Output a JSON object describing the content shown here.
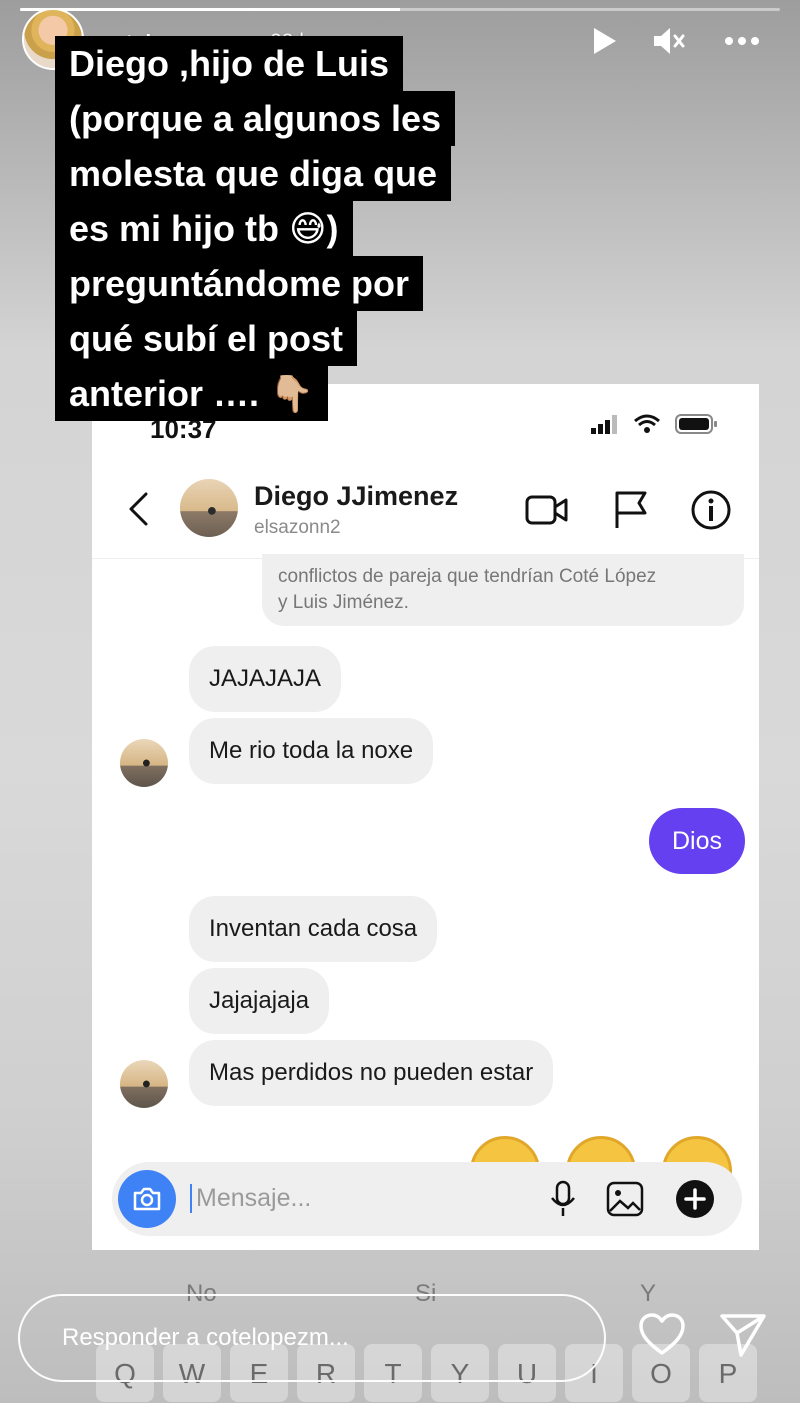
{
  "story": {
    "username": "cotelopezm",
    "time_ago": "22 h",
    "progress_fraction": 0.5,
    "icons": {
      "play": "play-icon",
      "mute": "mute-icon",
      "more": "more-icon"
    },
    "caption_lines": [
      "Diego ,hijo de Luis",
      "(porque a algunos les",
      "molesta que diga que",
      "es mi hijo tb 😅)",
      "preguntándome por",
      "qué subí el post",
      "anterior …. 👇🏼"
    ],
    "reply_placeholder": "Responder a cotelopezm...",
    "footer_icons": {
      "like": "heart-icon",
      "share": "send-icon"
    }
  },
  "phone": {
    "status_time": "10:37",
    "contact": {
      "name": "Diego JJimenez",
      "handle": "elsazonn2"
    },
    "quoted_text_lines": [
      "conflictos de pareja que tendrían Coté López",
      "y Luis Jiménez."
    ],
    "messages": [
      {
        "text": "JAJAJAJA",
        "from": "them"
      },
      {
        "text": "Me rio toda la noxe",
        "from": "them"
      },
      {
        "text": "Dios",
        "from": "me"
      },
      {
        "text": "Inventan cada cosa",
        "from": "them"
      },
      {
        "text": "Jajajajaja",
        "from": "them"
      },
      {
        "text": "Mas perdidos no pueden estar",
        "from": "them"
      }
    ],
    "message_placeholder": "Mensaje...",
    "colors": {
      "my_bubble": "#6440f0",
      "their_bubble": "#efefef",
      "camera": "#3f82f5"
    }
  },
  "keyboard": {
    "suggestions": [
      "No",
      "Si",
      "Y"
    ],
    "keys": [
      "Q",
      "W",
      "E",
      "R",
      "T",
      "Y",
      "U",
      "I",
      "O",
      "P"
    ]
  }
}
